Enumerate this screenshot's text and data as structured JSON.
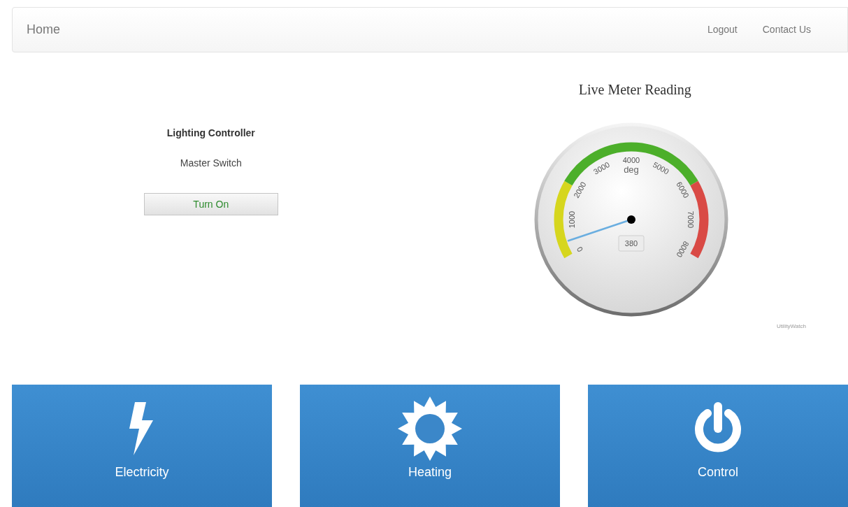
{
  "navbar": {
    "brand": "Home",
    "links": [
      "Logout",
      "Contact Us"
    ]
  },
  "lighting": {
    "title": "Lighting Controller",
    "subtitle": "Master Switch",
    "button": "Turn On"
  },
  "meter": {
    "title": "Live Meter Reading",
    "unit": "deg",
    "reading": "380",
    "credit": "UtilityWatch",
    "ticks": [
      "0",
      "1000",
      "2000",
      "3000",
      "4000",
      "5000",
      "6000",
      "7000",
      "8000"
    ],
    "bands": [
      {
        "color": "#d6d61e"
      },
      {
        "color": "#4caf2a"
      },
      {
        "color": "#d94a45"
      }
    ]
  },
  "tiles": [
    {
      "kind": "bolt",
      "label": "Electricity"
    },
    {
      "kind": "sun",
      "label": "Heating"
    },
    {
      "kind": "power",
      "label": "Control"
    }
  ]
}
